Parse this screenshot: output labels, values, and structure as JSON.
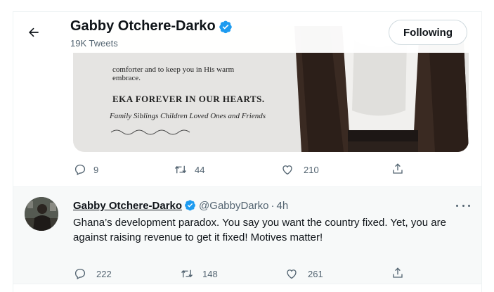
{
  "header": {
    "name": "Gabby Otchere-Darko",
    "tweet_count": "19K Tweets",
    "following_label": "Following"
  },
  "tweet1": {
    "media": {
      "line1": "comforter and to keep you in His warm",
      "line2": "embrace.",
      "line3": "EKA FOREVER IN OUR HEARTS.",
      "line4": "Family  Siblings  Children  Loved Ones  and Friends"
    },
    "actions": {
      "replies": "9",
      "retweets": "44",
      "likes": "210"
    }
  },
  "tweet2": {
    "name": "Gabby Otchere-Darko",
    "handle": "@GabbyDarko",
    "dot": "·",
    "time": "4h",
    "text": "Ghana’s development paradox. You say you want the country fixed. Yet, you are against raising revenue to get it fixed! Motives matter!",
    "actions": {
      "replies": "222",
      "retweets": "148",
      "likes": "261"
    }
  },
  "colors": {
    "verified": "#1d9bf0",
    "secondary_text": "#536471",
    "border": "#eff3f4"
  }
}
